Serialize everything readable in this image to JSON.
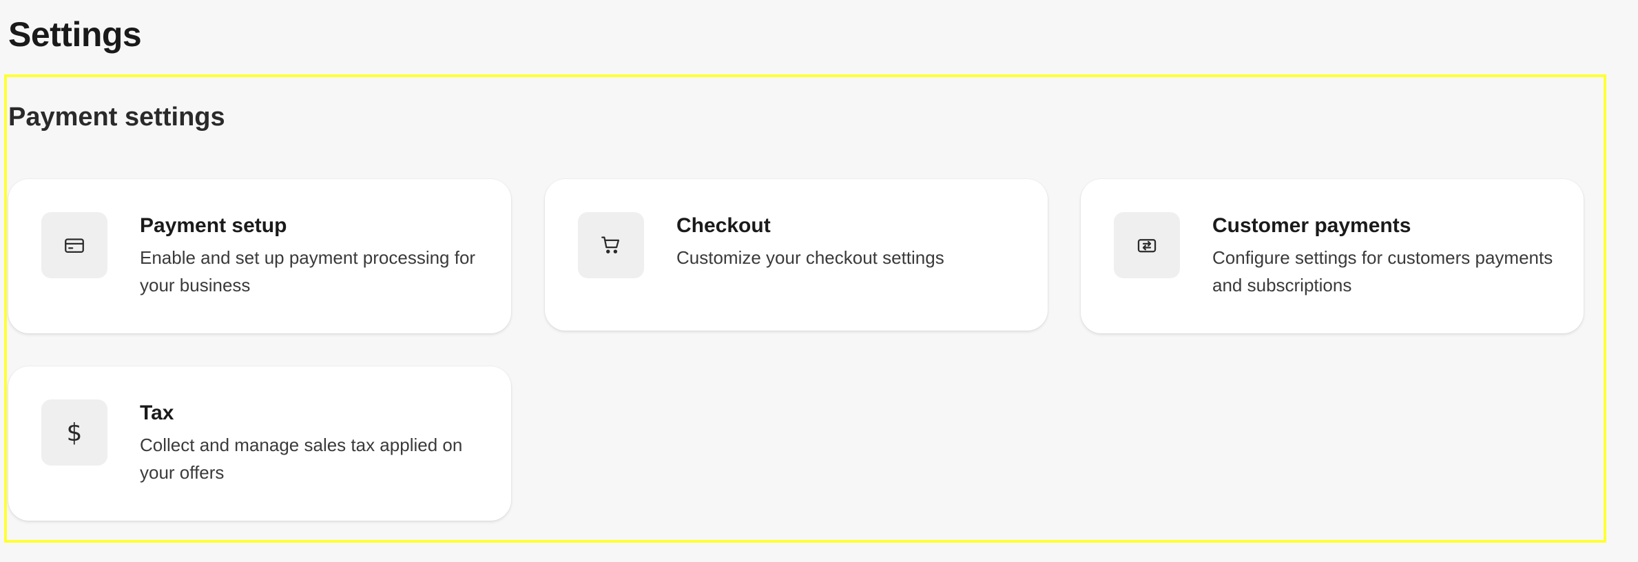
{
  "page": {
    "title": "Settings"
  },
  "section": {
    "title": "Payment settings"
  },
  "cards": [
    {
      "title": "Payment setup",
      "description": "Enable and set up payment processing for your business",
      "icon": "credit-card-icon"
    },
    {
      "title": "Checkout",
      "description": "Customize your checkout settings",
      "icon": "shopping-cart-icon"
    },
    {
      "title": "Customer payments",
      "description": "Configure settings for customers payments and subscriptions",
      "icon": "recurring-payment-icon"
    },
    {
      "title": "Tax",
      "description": "Collect and manage sales tax applied on your offers",
      "icon": "dollar-icon",
      "glyph": "$"
    }
  ],
  "colors": {
    "background": "#f7f7f7",
    "card": "#ffffff",
    "icon_box": "#efefef",
    "highlight": "#ffff33"
  }
}
